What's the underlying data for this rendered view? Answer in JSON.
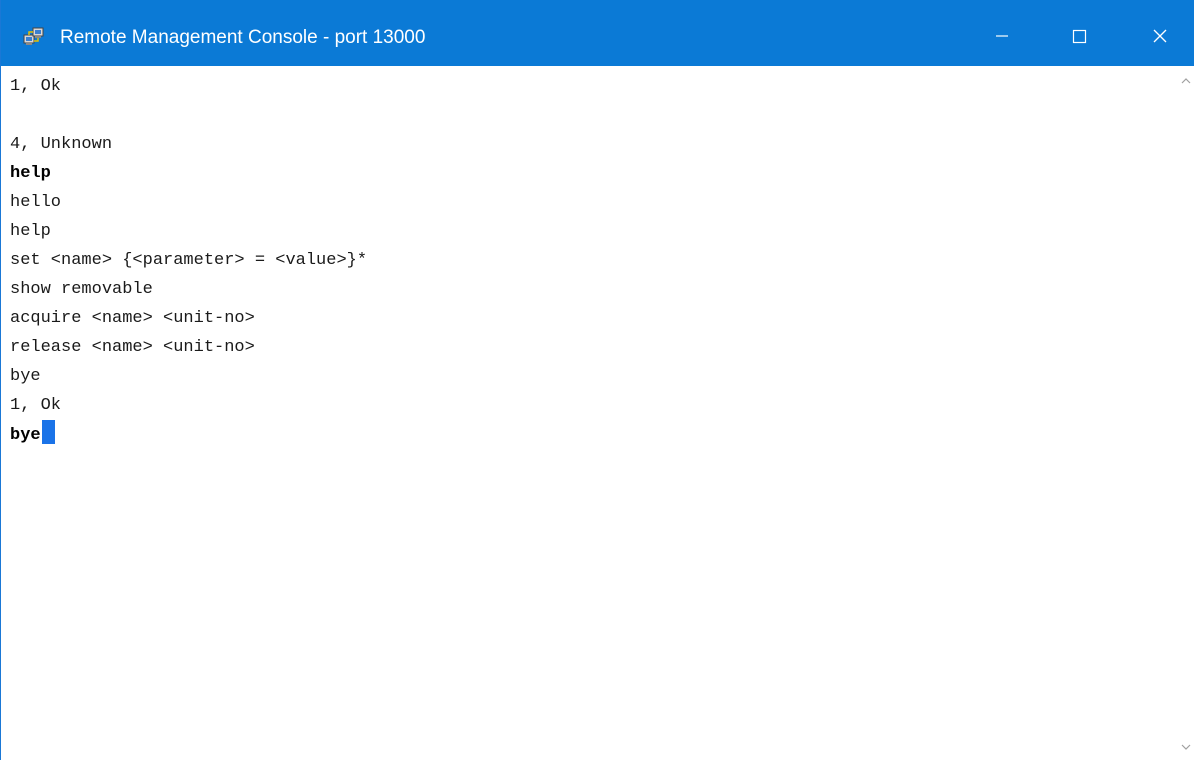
{
  "window": {
    "title": "Remote Management Console - port 13000",
    "app_icon": "network-computers-icon",
    "controls": {
      "minimize": "minimize-icon",
      "maximize": "maximize-icon",
      "close": "close-icon"
    },
    "colors": {
      "titlebar": "#0b7ad6",
      "cursor": "#1a73e8"
    }
  },
  "console": {
    "lines": [
      {
        "text": "1, Ok",
        "bold": false
      },
      {
        "text": "",
        "bold": false
      },
      {
        "text": "4, Unknown",
        "bold": false
      },
      {
        "text": "help",
        "bold": true
      },
      {
        "text": "hello",
        "bold": false
      },
      {
        "text": "help",
        "bold": false
      },
      {
        "text": "set <name> {<parameter> = <value>}*",
        "bold": false
      },
      {
        "text": "show removable",
        "bold": false
      },
      {
        "text": "acquire <name> <unit-no>",
        "bold": false
      },
      {
        "text": "release <name> <unit-no>",
        "bold": false
      },
      {
        "text": "bye",
        "bold": false
      },
      {
        "text": "1, Ok",
        "bold": false
      }
    ],
    "input": "bye"
  }
}
